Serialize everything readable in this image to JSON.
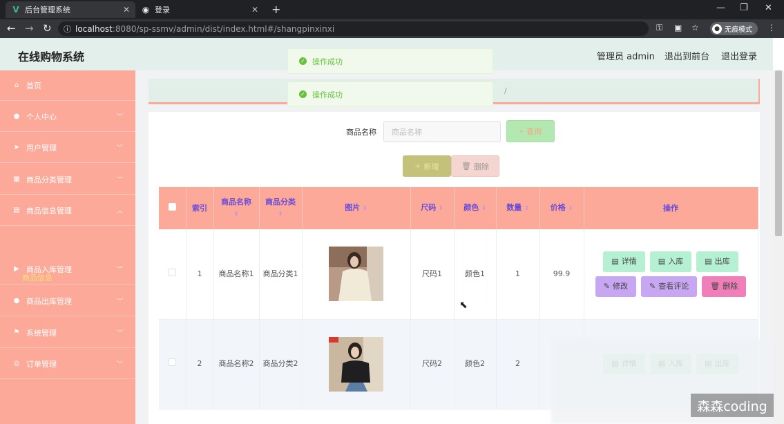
{
  "browser": {
    "tabs": [
      {
        "title": "后台管理系统",
        "icon": "vue-logo-icon"
      },
      {
        "title": "登录",
        "icon": "globe-icon"
      }
    ],
    "new_tab": "+",
    "url_host": "localhost",
    "url_path": ":8080/sp-ssmv/admin/dist/index.html#/shangpinxinxi",
    "incognito_label": "无痕模式",
    "window_controls": [
      "—",
      "❐",
      "✕"
    ]
  },
  "header": {
    "brand": "在线购物系统",
    "user": "管理员 admin",
    "front": "退出到前台",
    "logout": "退出登录"
  },
  "sidebar": {
    "items": [
      {
        "label": "首页",
        "icon": "home-icon",
        "glyph": "⌂"
      },
      {
        "label": "个人中心",
        "icon": "user-icon",
        "glyph": "●"
      },
      {
        "label": "用户管理",
        "icon": "send-icon",
        "glyph": "➤"
      },
      {
        "label": "商品分类管理",
        "icon": "grid-icon",
        "glyph": "▦"
      },
      {
        "label": "商品信息管理",
        "icon": "clipboard-icon",
        "glyph": "▤"
      },
      {
        "label": "商品入库管理",
        "icon": "video-icon",
        "glyph": "▶"
      },
      {
        "label": "商品出库管理",
        "icon": "user-icon",
        "glyph": "●"
      },
      {
        "label": "系统管理",
        "icon": "flag-icon",
        "glyph": "⚑"
      },
      {
        "label": "订单管理",
        "icon": "compass-icon",
        "glyph": "◎"
      }
    ],
    "active_sub": "商品信息"
  },
  "search": {
    "label": "商品名称",
    "placeholder": "商品名称",
    "query_btn": "查询",
    "add_btn": "新增",
    "del_btn": "删除"
  },
  "table": {
    "columns": [
      "索引",
      "商品名称",
      "商品分类",
      "图片",
      "尺码",
      "颜色",
      "数量",
      "价格",
      "操作"
    ],
    "rows": [
      {
        "index": "1",
        "name": "商品名称1",
        "category": "商品分类1",
        "size": "尺码1",
        "color": "颜色1",
        "qty": "1",
        "price": "99.9"
      },
      {
        "index": "2",
        "name": "商品名称2",
        "category": "商品分类2",
        "size": "尺码2",
        "color": "颜色2",
        "qty": "2",
        "price": ""
      }
    ],
    "ops": {
      "detail": "详情",
      "in": "入库",
      "out": "出库",
      "edit": "修改",
      "reviews": "查看评论",
      "delete": "删除"
    }
  },
  "toasts": [
    "操作成功",
    "操作成功"
  ],
  "watermark": "森森coding",
  "colors": {
    "sidebar": "#fda99a",
    "header": "#e3efea",
    "active_sub": "#f5e36e",
    "btn_green": "#b4f0d1",
    "btn_purple": "#c7a6f2",
    "btn_pink": "#f07eb9"
  }
}
